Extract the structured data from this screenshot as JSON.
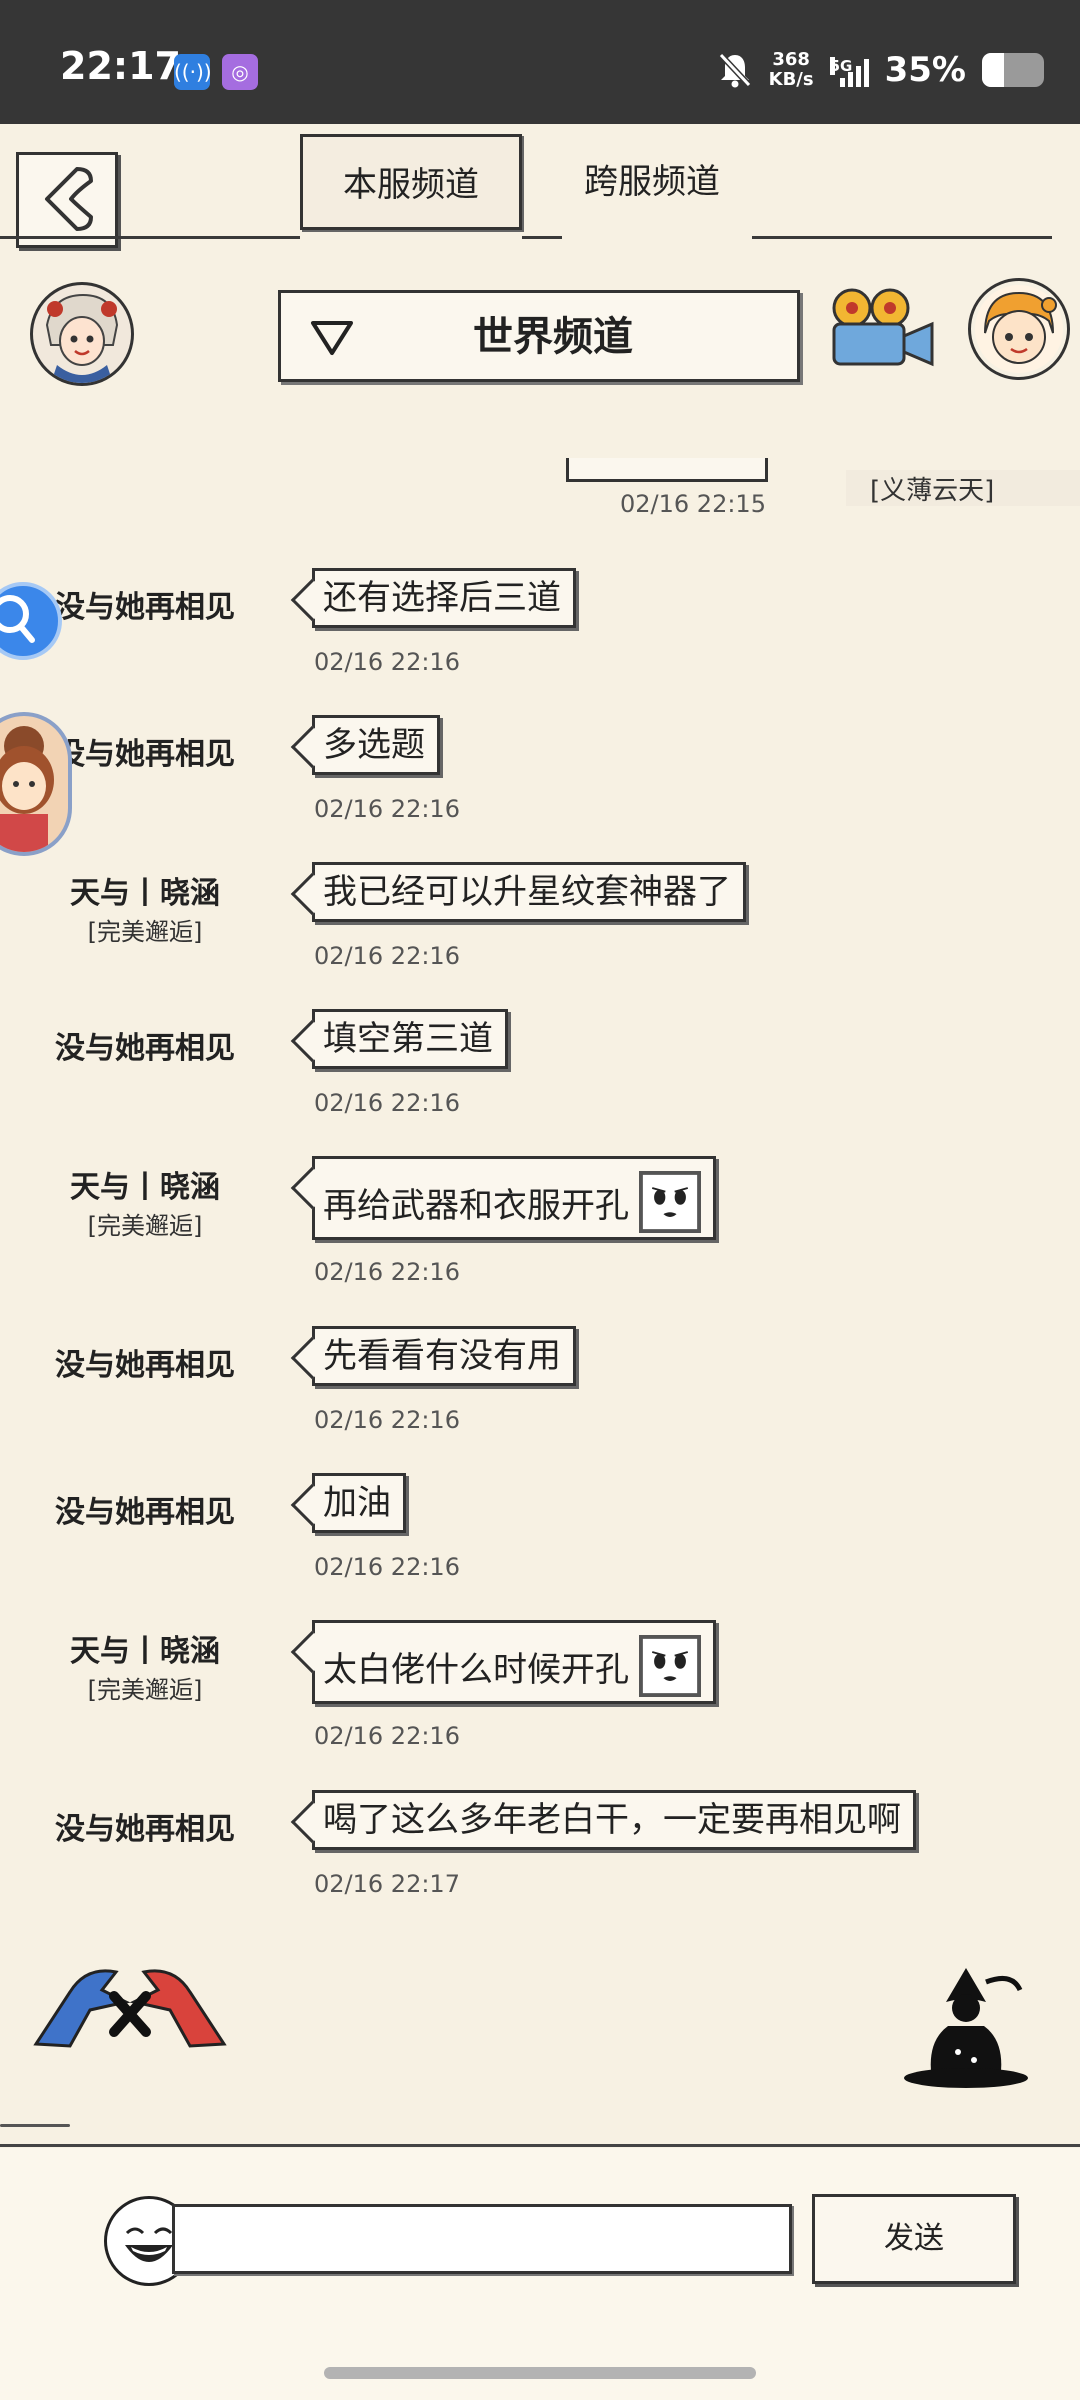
{
  "status_bar": {
    "time": "22:17",
    "speed_value": "368",
    "speed_unit": "KB/s",
    "network": "5G",
    "battery_percent_text": "35%",
    "battery_level": 0.35,
    "icons": [
      "hotspot-icon",
      "app-icon",
      "mute-bell-icon",
      "signal-icon",
      "battery-icon"
    ]
  },
  "tabs": [
    {
      "label": "本服频道",
      "active": true
    },
    {
      "label": "跨服频道",
      "active": false
    }
  ],
  "channel": {
    "selected": "世界频道"
  },
  "partial_message": {
    "sender": "[义薄云天]",
    "time": "02/16 22:15"
  },
  "messages": [
    {
      "sender": "没与她再相见",
      "tag": "",
      "text": "还有选择后三道",
      "emoji": false,
      "time": "02/16 22:16"
    },
    {
      "sender": "没与她再相见",
      "tag": "",
      "text": "多选题",
      "emoji": false,
      "time": "02/16 22:16"
    },
    {
      "sender": "天与丨晓涵",
      "tag": "[完美邂逅]",
      "text": "我已经可以升星纹套神器了",
      "emoji": false,
      "time": "02/16 22:16"
    },
    {
      "sender": "没与她再相见",
      "tag": "",
      "text": "填空第三道",
      "emoji": false,
      "time": "02/16 22:16"
    },
    {
      "sender": "天与丨晓涵",
      "tag": "[完美邂逅]",
      "text": "再给武器和衣服开孔",
      "emoji": true,
      "time": "02/16 22:16"
    },
    {
      "sender": "没与她再相见",
      "tag": "",
      "text": "先看看有没有用",
      "emoji": false,
      "time": "02/16 22:16"
    },
    {
      "sender": "没与她再相见",
      "tag": "",
      "text": "加油",
      "emoji": false,
      "time": "02/16 22:16"
    },
    {
      "sender": "天与丨晓涵",
      "tag": "[完美邂逅]",
      "text": "太白佬什么时候开孔",
      "emoji": true,
      "time": "02/16 22:16"
    },
    {
      "sender": "没与她再相见",
      "tag": "",
      "text": "喝了这么多年老白干，一定要再相见啊",
      "emoji": false,
      "time": "02/16 22:17"
    }
  ],
  "input": {
    "value": "",
    "placeholder": ""
  },
  "send_button": {
    "label": "发送"
  }
}
